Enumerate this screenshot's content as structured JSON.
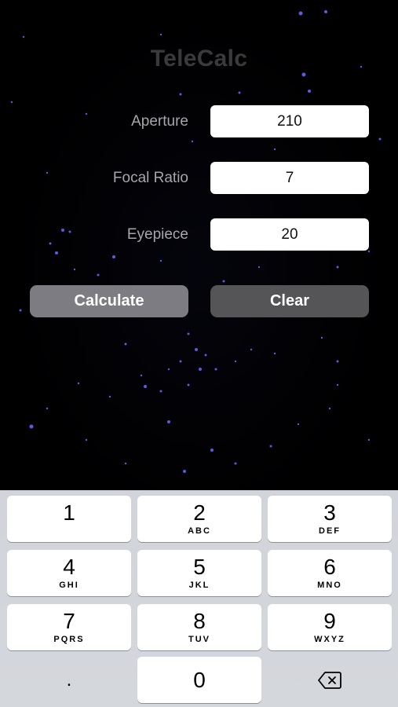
{
  "app": {
    "title": "TeleCalc"
  },
  "fields": {
    "aperture": {
      "label": "Aperture",
      "value": "210"
    },
    "focal_ratio": {
      "label": "Focal Ratio",
      "value": "7"
    },
    "eyepiece": {
      "label": "Eyepiece",
      "value": "20"
    }
  },
  "buttons": {
    "calculate": "Calculate",
    "clear": "Clear"
  },
  "keypad": {
    "keys": [
      {
        "digit": "1",
        "letters": ""
      },
      {
        "digit": "2",
        "letters": "ABC"
      },
      {
        "digit": "3",
        "letters": "DEF"
      },
      {
        "digit": "4",
        "letters": "GHI"
      },
      {
        "digit": "5",
        "letters": "JKL"
      },
      {
        "digit": "6",
        "letters": "MNO"
      },
      {
        "digit": "7",
        "letters": "PQRS"
      },
      {
        "digit": "8",
        "letters": "TUV"
      },
      {
        "digit": "9",
        "letters": "WXYZ"
      },
      {
        "digit": "0",
        "letters": ""
      }
    ],
    "decimal": ".",
    "delete_icon": "backspace-icon"
  }
}
